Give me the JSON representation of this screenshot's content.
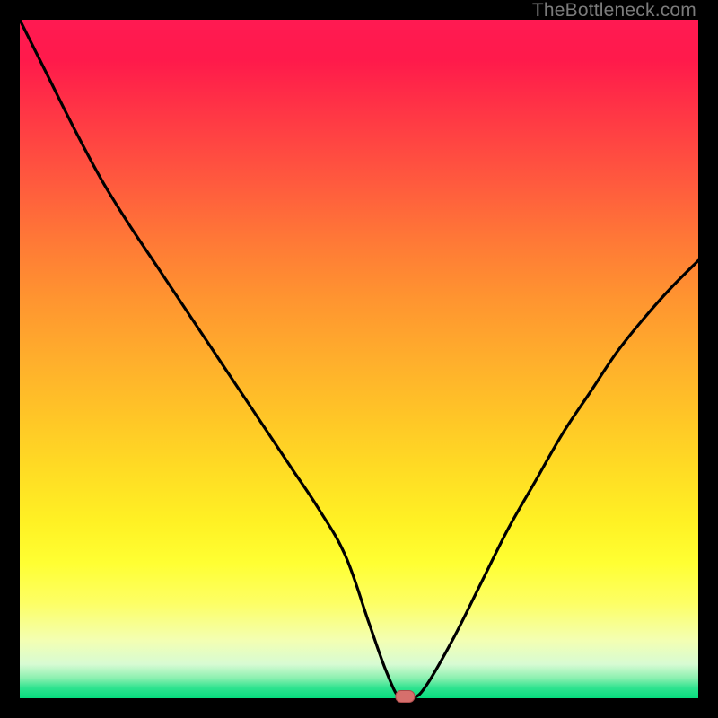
{
  "watermark": "TheBottleneck.com",
  "colors": {
    "frame": "#000000",
    "curve": "#000000",
    "marker_fill": "#d66f6c",
    "marker_stroke": "#a94b4b"
  },
  "chart_data": {
    "type": "line",
    "title": "",
    "xlabel": "",
    "ylabel": "",
    "xlim": [
      0,
      100
    ],
    "ylim": [
      0,
      100
    ],
    "grid": false,
    "legend": false,
    "series": [
      {
        "name": "bottleneck-curve",
        "x": [
          0,
          4,
          8,
          12,
          16,
          20,
          24,
          28,
          32,
          36,
          40,
          44,
          48,
          51.5,
          54,
          56,
          58,
          60,
          64,
          68,
          72,
          76,
          80,
          84,
          88,
          92,
          96,
          100
        ],
        "values": [
          100,
          92,
          84,
          76.5,
          70,
          64,
          58,
          52,
          46,
          40,
          34,
          28,
          21,
          11,
          4,
          0,
          0,
          2,
          9,
          17,
          25,
          32,
          39,
          45,
          51,
          56,
          60.5,
          64.5
        ]
      }
    ],
    "marker": {
      "x": 56.8,
      "y": 0
    },
    "gradient_stops": [
      {
        "pct": 0,
        "color": "#ff1a52"
      },
      {
        "pct": 24,
        "color": "#ff5a3e"
      },
      {
        "pct": 50,
        "color": "#ffae2c"
      },
      {
        "pct": 74,
        "color": "#fff124"
      },
      {
        "pct": 91.5,
        "color": "#f3ffb3"
      },
      {
        "pct": 100,
        "color": "#07dc7e"
      }
    ]
  }
}
